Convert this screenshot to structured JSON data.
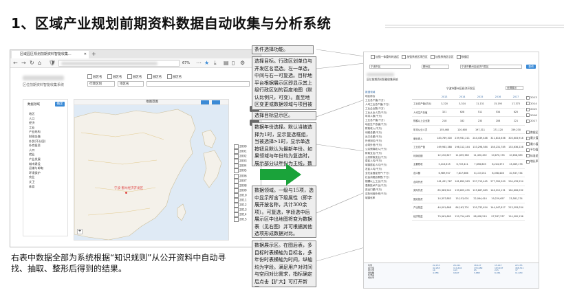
{
  "slide": {
    "title": "1、区域产业规划前期资料数据自动收集与分析系统",
    "footer": "右表中数据全部为系统根据“知识规则”从公开资料中自动寻找、抽取、整形后得到的结果。"
  },
  "browser": {
    "tab_title": "区域园区规划前期资料智能收集...",
    "new_tab": "+",
    "zoom": "67%",
    "app_title": "区位前期资料智能收集系统"
  },
  "left_panel": {
    "header": "数据领域",
    "button": "确定",
    "items": [
      "地区",
      "人口",
      "经济",
      "工业",
      "产业结构",
      "财政金融",
      "外贸(不分国)",
      "外商投资",
      "人口",
      "就业",
      "产业发展",
      "城市建设",
      "运输与邮电",
      "环境保护",
      "农业",
      "文卫",
      "体育"
    ]
  },
  "filters": {
    "checkboxes": [
      "园区名",
      "园区名",
      "园区名",
      "园区名",
      "园区名"
    ],
    "region": "行政区划",
    "region2": "地区名"
  },
  "map": {
    "header": "地图范围",
    "tag": "宁波-鄞州经济开发区"
  },
  "year_list": [
    "2000",
    "2001",
    "2002",
    "2003",
    "2004",
    "2005",
    "2006",
    "2007",
    "2008",
    "2009",
    "2010",
    "2011",
    "2012",
    "2013",
    "2014",
    "2015"
  ],
  "annotations": {
    "a1": "条件选择功能。",
    "a2": "选择目标。行政区划单位与开发区名混选。左一单选，中间与右一可复选。目标地平台根据展示区即显示其上级行政区划的百度地图（默认比例尺，可变）。直至地区变更或数据领域与项目被选中。",
    "a3": "选择目标显示区。",
    "a4": "数据年份选择。默认当被选择为1时，显示复选框组，当被选择>1时，显示单选按钮且默认为最新年份。如果领域与年份均为复选时，展示部分以年份为主线，数据按领域分别显示。",
    "a5": "数据领域。一级与15项，选中显示所含下级属性（即字展开按名称，共计300余项）。可复选，字段选中后展示区中出地图将变为数据表（见右图）并可根据其他选项形成数据对比。",
    "a6": "数据展示区。在图后表，多目标时表横轴为目标名，多年份时表横轴为时间，纵轴均为字段。满足用户对时间与空间对比需求，指标确定后点击【扩大】可打开新页。"
  },
  "right_shot": {
    "top_checks": [
      "加强一体重构的选区",
      "加强系统区项目区",
      "加强系统区总区",
      "数据区"
    ],
    "select1": "宁波市区",
    "select2": "鄞州区",
    "select3": "宁波市鄞州区经济开发区",
    "search": "查询",
    "app_title": "区位前期资料智能收集系统",
    "tree_header": "数据领域",
    "tree_items": [
      "地区综合",
      "工业总产值(千万)",
      "人均工业总产值(千万)",
      "工业企业数(千万)",
      "工业从业人员(千万)",
      "年末人数(千万)",
      "工业总产值(千万)",
      "地区生产总值(千万)",
      "财政收入(千万)",
      "利税总额(千万)",
      "出口总额(千万)",
      "外资到位(千万)",
      "合同外资(千万)",
      "公共预算收入(千万)",
      "财政支出(千万)",
      "公共财政支出(千万)",
      "居民人均(千万)",
      "城镇居民人均(千万)",
      "农民人均(千万)",
      "全社会固定资产(千万)",
      "社会消费品零售(千万)",
      "规模以上工业(千万)",
      "高新技术产业(千万)",
      "进出口额(千万)",
      "实际利用外资(千万)",
      "城镇化率"
    ],
    "table_title": "宁波市鄞州区经济开发区",
    "expand": "全屏展示",
    "year_headers": [
      "2013",
      "2014",
      "2015",
      "2016",
      "2017"
    ],
    "rows": [
      {
        "label": "工业总产值(亿元)",
        "v": [
          "3,220",
          "3,314",
          "11,131",
          "15,195",
          "17,373"
        ]
      },
      {
        "label": "人均生产总值",
        "v": [
          "321",
          "628",
          "511",
          "534",
          "625"
        ]
      },
      {
        "label": "规模以上企业数",
        "v": [
          "218",
          "182",
          "233",
          "208",
          "221"
        ]
      },
      {
        "label": "年末从业人员",
        "v": [
          "155,460",
          "120,600",
          "197,311",
          "171,120",
          "159,230"
        ]
      },
      {
        "label": "营业收入",
        "v": [
          "183,789,300",
          "239,931,211",
          "244,439,448",
          "311,813,636",
          "303,603,918"
        ]
      },
      {
        "label": "工业总产值",
        "v": [
          "169,983,388",
          "198,112,144",
          "133,298,584",
          "158,231,785",
          "133,636,228"
        ]
      },
      {
        "label": "利润总额",
        "v": [
          "12,152,627",
          "11,699,385",
          "11,490,492",
          "10,670,176",
          "10,658,989"
        ]
      },
      {
        "label": "主要税收",
        "v": [
          "5,413,615",
          "6,719,411",
          "7,656,803",
          "8,224,373",
          "13,469,176"
        ]
      },
      {
        "label": "出口额",
        "v": [
          "6,989,907",
          "7,817,666",
          "8,172,031",
          "8,058,408",
          "10,537,734"
        ]
      },
      {
        "label": "合同外资",
        "v": [
          "161,431,767",
          "161,859,563",
          "237,713,445",
          "277,399,200",
          "294,433,224"
        ]
      },
      {
        "label": "实际外资",
        "v": [
          "85,383,540",
          "139,625,435",
          "125,667,663",
          "146,012,131",
          "164,606,032"
        ]
      },
      {
        "label": "固定投资",
        "v": [
          "14,357,883",
          "15,153,001",
          "22,064,414",
          "19,229,657",
          "23,581,274"
        ]
      },
      {
        "label": "产出效益",
        "v": [
          "44,091,668",
          "84,163,701",
          "130,732,614",
          "144,047,817",
          "213,593,034"
        ]
      },
      {
        "label": "经济效益",
        "v": [
          "79,961,665",
          "120,714,463",
          "98,438,510",
          "97,287,237",
          "114,000,136"
        ]
      }
    ],
    "stats": {
      "rows": [
        "均值",
        "最大值",
        "最小值",
        "中位数",
        "标准差",
        "增长率"
      ],
      "col1": [
        "22,155",
        "42,265",
        "16",
        "4,558"
      ],
      "col2": [
        "26,411",
        "119,404",
        "143",
        "9,647"
      ],
      "col3": [
        "18,147",
        "135,689",
        "65",
        "3,688"
      ],
      "col4": [
        "15,147",
        "163,497",
        "215",
        "6,061"
      ],
      "col5": [
        "22,155",
        "468,311",
        "37",
        "11,630"
      ]
    },
    "right_checks": [
      "2013",
      "2014",
      "2015",
      "2016",
      "2017",
      "数据区",
      "最大值",
      "最小值",
      "平均值",
      "标准差",
      "增长率"
    ]
  },
  "colors": {
    "arrow": "#1aa33a",
    "accent": "#3a8ad6",
    "map_label": "#e04848"
  }
}
